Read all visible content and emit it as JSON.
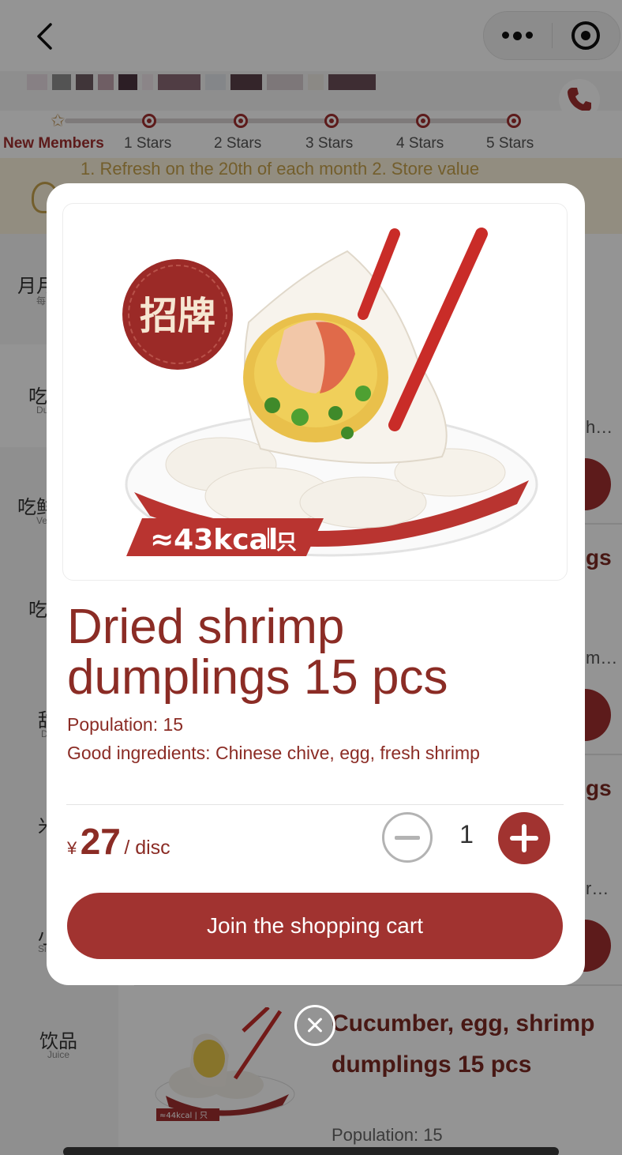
{
  "nav": {
    "back_icon": "chevron-left-icon",
    "menu_icon": "more-dots-icon",
    "close_icon": "target-circle-icon",
    "phone_icon": "phone-icon"
  },
  "levels": [
    {
      "label": "New Members"
    },
    {
      "label": "1 Stars"
    },
    {
      "label": "2 Stars"
    },
    {
      "label": "3 Stars"
    },
    {
      "label": "4 Stars"
    },
    {
      "label": "5 Stars"
    }
  ],
  "notice": {
    "text": "1. Refresh on the 20th of each month 2. Store value"
  },
  "sidebar": {
    "items": [
      {
        "zh": "月月",
        "en": "每"
      },
      {
        "zh": "吃",
        "en": "Du"
      },
      {
        "zh": "吃鲜",
        "en": "Ve"
      },
      {
        "zh": "吃",
        "en": ""
      },
      {
        "zh": "甜",
        "en": "D"
      },
      {
        "zh": "米",
        "en": ""
      },
      {
        "zh": "小",
        "en": "Si"
      }
    ],
    "juice": {
      "zh": "饮品",
      "en": "Juice"
    }
  },
  "peek": {
    "t1": "h…",
    "t2": "gs",
    "t3": "m…",
    "t4": "gs",
    "t5": "r…"
  },
  "bottom_item": {
    "title": "Cucumber, egg, shrimp dumplings 15 pcs",
    "population": "Population: 15",
    "thumb_kcal": "≈44kcal | 只"
  },
  "modal": {
    "image_badge": "招牌",
    "kcal": "≈43kcal",
    "kcal_unit": "只",
    "title": "Dried shrimp dumplings 15 pcs",
    "population": "Population: 15",
    "ingredients": "Good ingredients: Chinese chive, egg, fresh shrimp",
    "currency": "¥",
    "price": "27",
    "unit": "/ disc",
    "quantity": "1",
    "cart_button": "Join the shopping cart"
  },
  "colors": {
    "brand": "#a13330",
    "title": "#8b2c25"
  }
}
